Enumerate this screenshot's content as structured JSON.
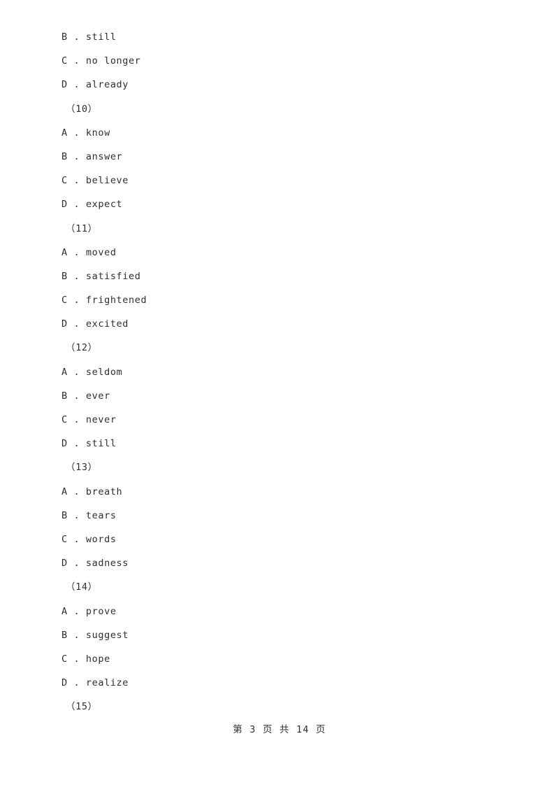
{
  "document": {
    "page_label": "第 3 页 共 14 页",
    "page_number": "3",
    "total_pages": "14",
    "text_color": "#2f2f2f",
    "background_color": "#ffffff"
  },
  "blocks": [
    {
      "kind": "option",
      "text": "B . still"
    },
    {
      "kind": "option",
      "text": "C . no longer"
    },
    {
      "kind": "option",
      "text": "D . already"
    },
    {
      "kind": "question",
      "text": "（10）"
    },
    {
      "kind": "option",
      "text": "A . know"
    },
    {
      "kind": "option",
      "text": "B . answer"
    },
    {
      "kind": "option",
      "text": "C . believe"
    },
    {
      "kind": "option",
      "text": "D . expect"
    },
    {
      "kind": "question",
      "text": "（11）"
    },
    {
      "kind": "option",
      "text": "A . moved"
    },
    {
      "kind": "option",
      "text": "B . satisfied"
    },
    {
      "kind": "option",
      "text": "C . frightened"
    },
    {
      "kind": "option",
      "text": "D . excited"
    },
    {
      "kind": "question",
      "text": "（12）"
    },
    {
      "kind": "option",
      "text": "A . seldom"
    },
    {
      "kind": "option",
      "text": "B . ever"
    },
    {
      "kind": "option",
      "text": "C . never"
    },
    {
      "kind": "option",
      "text": "D . still"
    },
    {
      "kind": "question",
      "text": "（13）"
    },
    {
      "kind": "option",
      "text": "A . breath"
    },
    {
      "kind": "option",
      "text": "B . tears"
    },
    {
      "kind": "option",
      "text": "C . words"
    },
    {
      "kind": "option",
      "text": "D . sadness"
    },
    {
      "kind": "question",
      "text": "（14）"
    },
    {
      "kind": "option",
      "text": "A . prove"
    },
    {
      "kind": "option",
      "text": "B . suggest"
    },
    {
      "kind": "option",
      "text": "C . hope"
    },
    {
      "kind": "option",
      "text": "D . realize"
    },
    {
      "kind": "question",
      "text": "（15）"
    }
  ]
}
